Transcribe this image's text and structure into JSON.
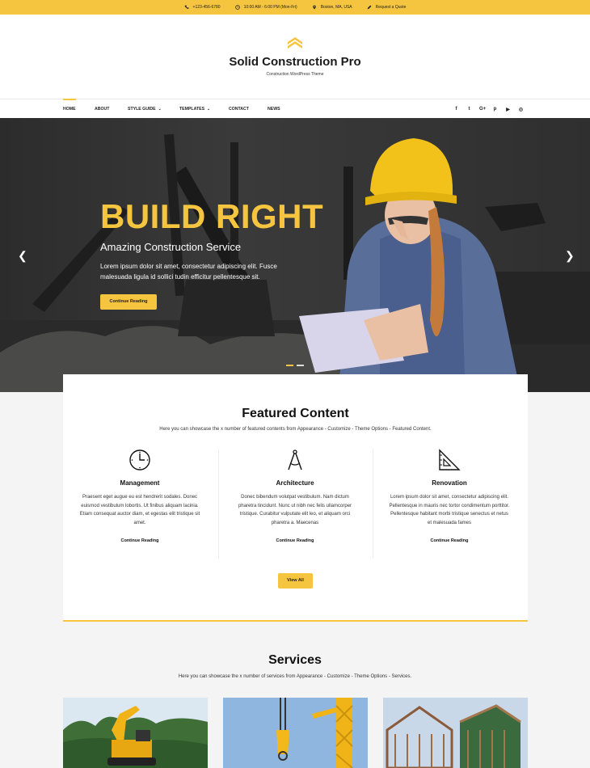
{
  "topbar": {
    "phone": "+123-456-6780",
    "hours": "10:00 AM - 6:00 PM (Mon-Fri)",
    "location": "Boston, MA, USA",
    "quote": "Request a Quote"
  },
  "header": {
    "title": "Solid Construction Pro",
    "tagline": "Construction WordPress Theme"
  },
  "nav": {
    "items": [
      {
        "label": "HOME"
      },
      {
        "label": "ABOUT"
      },
      {
        "label": "STYLE GUIDE"
      },
      {
        "label": "TEMPLATES"
      },
      {
        "label": "CONTACT"
      },
      {
        "label": "NEWS"
      }
    ],
    "socials": [
      "f",
      "t",
      "G+",
      "p",
      "▶",
      "◎"
    ]
  },
  "hero": {
    "title": "BUILD RIGHT",
    "subtitle": "Amazing Construction Service",
    "text": "Lorem ipsum dolor sit amet, consectetur adipiscing elit. Fusce malesuada ligula id sollici tudin efficitur pellentesque sit.",
    "button": "Continue Reading",
    "prev": "❮",
    "next": "❯"
  },
  "featured": {
    "title": "Featured Content",
    "subtitle": "Here you can showcase the x number of featured contents from Appearance - Customize - Theme Options - Featured Content.",
    "items": [
      {
        "title": "Management",
        "text": "Praesent eget augue eu est hendrerit sodales. Donec euismod vestibulum lobortis. Ut finibus aliquam lacinia. Etiam consequat auctor diam, et egestas elit tristique sit amet.",
        "link": "Continue Reading",
        "icon": "clock-icon"
      },
      {
        "title": "Architecture",
        "text": "Donec bibendum volutpat vestibulum. Nam dictum pharetra tincidunt. Nunc ut nibh nec felis ullamcorper tristique. Curabitur vulputate elit leo, et aliquam orci pharetra a. Maecenas",
        "link": "Continue Reading",
        "icon": "compass-icon"
      },
      {
        "title": "Renovation",
        "text": "Lorem ipsum dolor sit amet, consectetur adipiscing elit. Pellentesque in mauris nec tortor condimentum porttitor. Pellentesque habitant morbi tristique senectus et netus et malesuada fames",
        "link": "Continue Reading",
        "icon": "set-square-icon"
      }
    ],
    "button": "View All"
  },
  "services": {
    "title": "Services",
    "subtitle": "Here you can showcase the x number of services from Appearance - Customize - Theme Options - Services."
  },
  "colors": {
    "accent": "#f5c540"
  }
}
